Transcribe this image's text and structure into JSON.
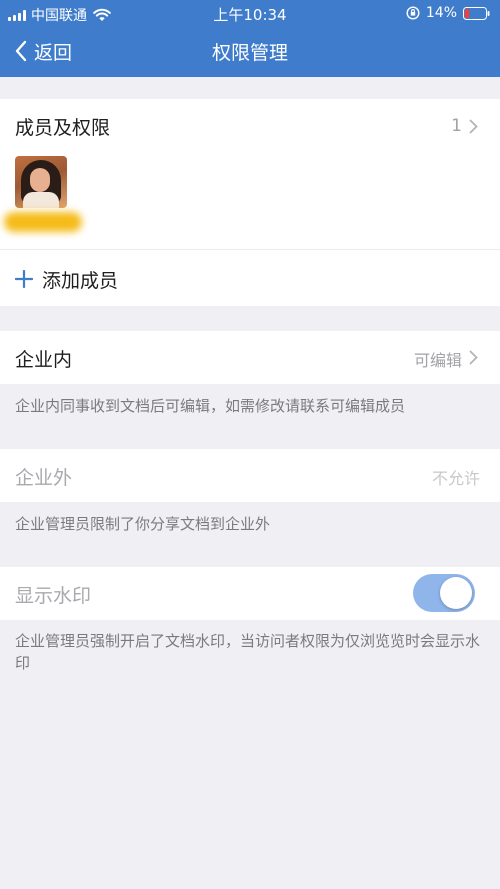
{
  "status_bar": {
    "carrier": "中国联通",
    "time": "上午10:34",
    "battery": "14%"
  },
  "nav": {
    "back_label": "返回",
    "title": "权限管理"
  },
  "members": {
    "title": "成员及权限",
    "count": "1",
    "add_label": "添加成员"
  },
  "internal": {
    "label": "企业内",
    "value": "可编辑",
    "note": "企业内同事收到文档后可编辑，如需修改请联系可编辑成员"
  },
  "external": {
    "label": "企业外",
    "value": "不允许",
    "note": "企业管理员限制了你分享文档到企业外"
  },
  "watermark": {
    "label": "显示水印",
    "enabled": true,
    "note": "企业管理员强制开启了文档水印，当访问者权限为仅浏览览时会显示水印"
  },
  "colors": {
    "header": "#3f7ccc",
    "accent": "#3f7ccc",
    "toggle_on_disabled": "#8fb5eb",
    "background": "#efeff4"
  },
  "icons": [
    "signal-icon",
    "wifi-icon",
    "rotation-lock-icon",
    "battery-icon",
    "back-chevron-icon",
    "chevron-right-icon",
    "plus-icon"
  ]
}
